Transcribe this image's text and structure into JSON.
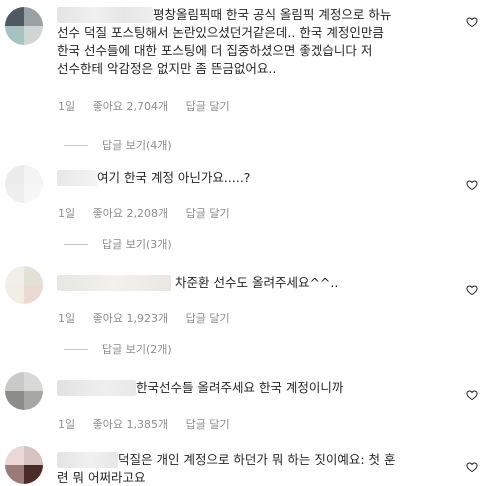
{
  "comments": [
    {
      "lines": [
        "평창올림픽때 한국 공식 올림픽 계정으로 하뉴",
        "선수 덕질 포스팅해서 논란있으셨던거같은데.. 한국 계정인만큼",
        "한국 선수들에 대한 포스팅에 더 집중하셨으면 좋겠습니다 저",
        "선수한테 악감정은 없지만 좀 뜬금없어요.."
      ],
      "time": "1일",
      "likes": "좋아요 2,704개",
      "reply": "답글 달기",
      "view_replies": "답글 보기(4개)"
    },
    {
      "lines": [
        "여기 한국 계정 아닌가요.....?"
      ],
      "time": "1일",
      "likes": "좋아요 2,208개",
      "reply": "답글 달기",
      "view_replies": "답글 보기(3개)"
    },
    {
      "lines": [
        "차준환 선수도 올려주세요^^.."
      ],
      "time": "1일",
      "likes": "좋아요 1,923개",
      "reply": "답글 달기",
      "view_replies": "답글 보기(2개)"
    },
    {
      "lines": [
        "한국선수들 올려주세요 한국 계정이니까"
      ],
      "time": "1일",
      "likes": "좋아요 1,385개",
      "reply": "답글 달기"
    },
    {
      "lines": [
        "덕질은 개인 계정으로 하던가 뭐 하는 짓이예요: 첫 훈",
        "련 뭐 어쩌라고요"
      ]
    }
  ],
  "colors": {
    "text": "#262626",
    "meta": "#8e8e8e",
    "heart": "#262626"
  },
  "icons": {
    "like": "heart-outline-icon"
  }
}
